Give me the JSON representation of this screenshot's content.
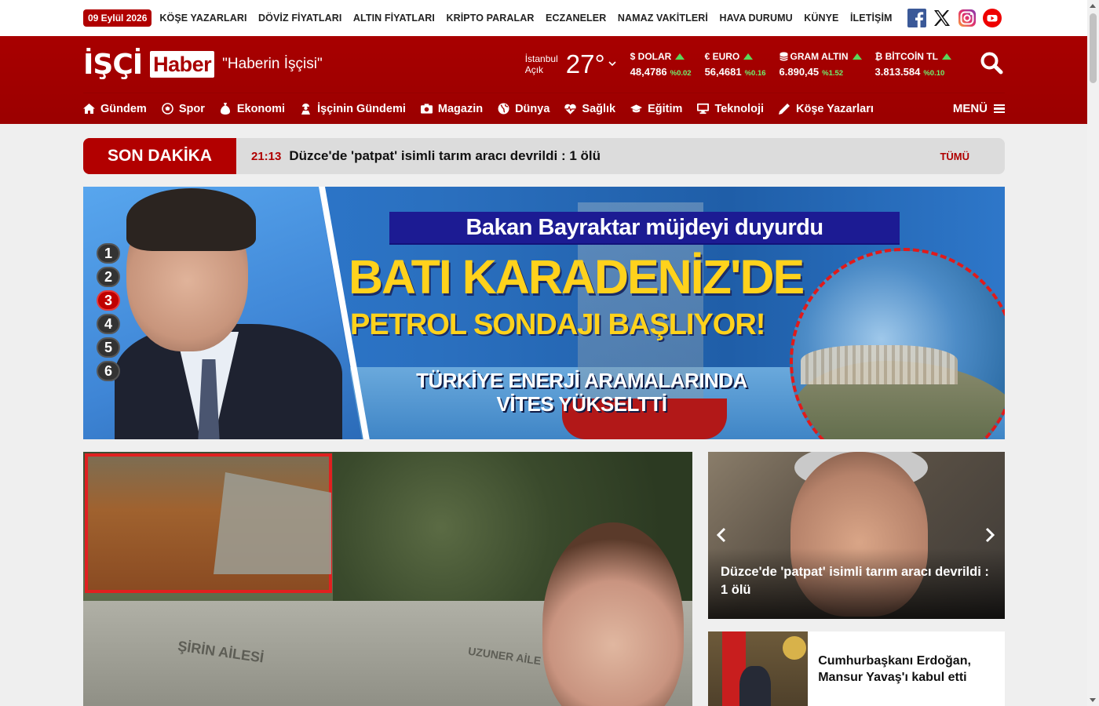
{
  "topbar": {
    "date": "09 Eylül 2026",
    "links": [
      "KÖŞE YAZARLARI",
      "DÖVİZ FİYATLARI",
      "ALTIN FİYATLARI",
      "KRİPTO PARALAR",
      "ECZANELER",
      "NAMAZ VAKİTLERİ",
      "HAVA DURUMU",
      "KÜNYE",
      "İLETİŞİM"
    ],
    "social": [
      "facebook-icon",
      "x-icon",
      "instagram-icon",
      "youtube-icon"
    ]
  },
  "header": {
    "logo_part1": "İŞÇİ",
    "logo_part2": "Haber",
    "slogan": "\"Haberin İşçisi\"",
    "weather": {
      "city": "İstanbul",
      "condition": "Açık",
      "temp": "27°"
    },
    "rates": [
      {
        "name": "$ DOLAR",
        "value": "48,4786",
        "change": "%0.02"
      },
      {
        "name": "€ EURO",
        "value": "56,4681",
        "change": "%0.16"
      },
      {
        "name": "GRAM ALTIN",
        "value": "6.890,45",
        "change": "%1.52"
      },
      {
        "name": "₿ BİTCOİN TL",
        "value": "3.813.584",
        "change": "%0.10"
      }
    ],
    "colors": {
      "brand": "#a80000",
      "up": "#5ad85a"
    }
  },
  "nav": {
    "items": [
      {
        "label": "Gündem",
        "icon": "home-icon"
      },
      {
        "label": "Spor",
        "icon": "football-icon"
      },
      {
        "label": "Ekonomi",
        "icon": "money-bag-icon"
      },
      {
        "label": "İşçinin Gündemi",
        "icon": "worker-icon"
      },
      {
        "label": "Magazin",
        "icon": "camera-icon"
      },
      {
        "label": "Dünya",
        "icon": "globe-icon"
      },
      {
        "label": "Sağlık",
        "icon": "heartbeat-icon"
      },
      {
        "label": "Eğitim",
        "icon": "graduation-cap-icon"
      },
      {
        "label": "Teknoloji",
        "icon": "monitor-icon"
      },
      {
        "label": "Köşe Yazarları",
        "icon": "pen-icon"
      }
    ],
    "menu_label": "MENÜ"
  },
  "breaking": {
    "label": "SON DAKİKA",
    "time": "21:13",
    "text": "Düzce'de 'patpat' isimli tarım aracı devrildi : 1 ölü",
    "all_label": "TÜMÜ"
  },
  "hero": {
    "slide_numbers": [
      "1",
      "2",
      "3",
      "4",
      "5",
      "6"
    ],
    "active_slide": "3",
    "subtitle": "Bakan Bayraktar müjdeyi duyurdu",
    "headline1": "BATI KARADENİZ'DE",
    "headline2": "PETROL SONDAJI BAŞLIYOR!",
    "footline1": "TÜRKİYE ENERJİ ARAMALARINDA",
    "footline2": "VİTES YÜKSELTTİ"
  },
  "main_story": {
    "grave_text1": "ŞİRİN AİLESİ",
    "grave_text2": "UZUNER AİLE"
  },
  "side": {
    "card1_title": "Düzce'de 'patpat' isimli tarım aracı devrildi : 1 ölü",
    "card2_title": "Cumhurbaşkanı Erdoğan, Mansur Yavaş'ı kabul etti"
  }
}
